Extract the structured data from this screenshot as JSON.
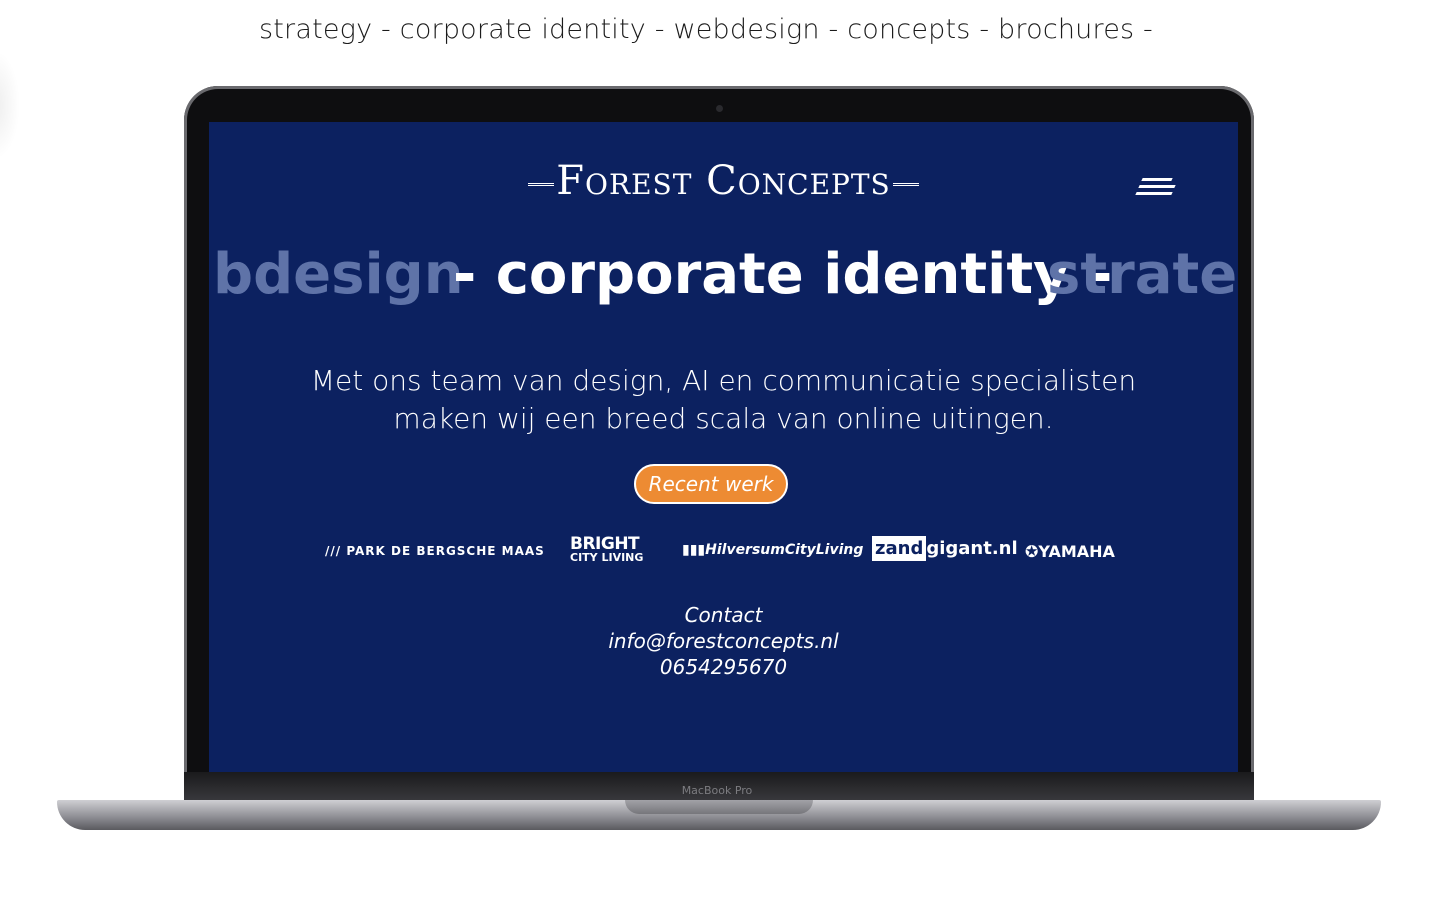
{
  "tagline": "strategy - corporate identity - webdesign - concepts - brochures -",
  "device_label": "MacBook Pro",
  "site": {
    "brand": "Forest Concepts",
    "menu_icon": "hamburger-icon",
    "marquee": {
      "left": "bdesign",
      "center": "- corporate identity -",
      "right": "strateg"
    },
    "intro_line1": "Met ons team van design, AI en communicatie specialisten",
    "intro_line2": "maken wij een breed scala van online uitingen.",
    "cta_label": "Recent werk",
    "logos": {
      "park": "/// PARK DE BERGSCHE MAAS",
      "bright_top": "BRIGHT",
      "bright_bottom": "CITY LIVING",
      "hilversum": "HilversumCityLiving",
      "zand_box": "zand",
      "zand_rest": "gigant.nl",
      "yamaha": "YAMAHA"
    },
    "contact": {
      "heading": "Contact",
      "email": "info@forestconcepts.nl",
      "phone": "0654295670"
    }
  },
  "colors": {
    "screen_bg": "#0c2160",
    "cta_bg": "#ed8b33",
    "marquee_dim": "#5f73a8"
  }
}
